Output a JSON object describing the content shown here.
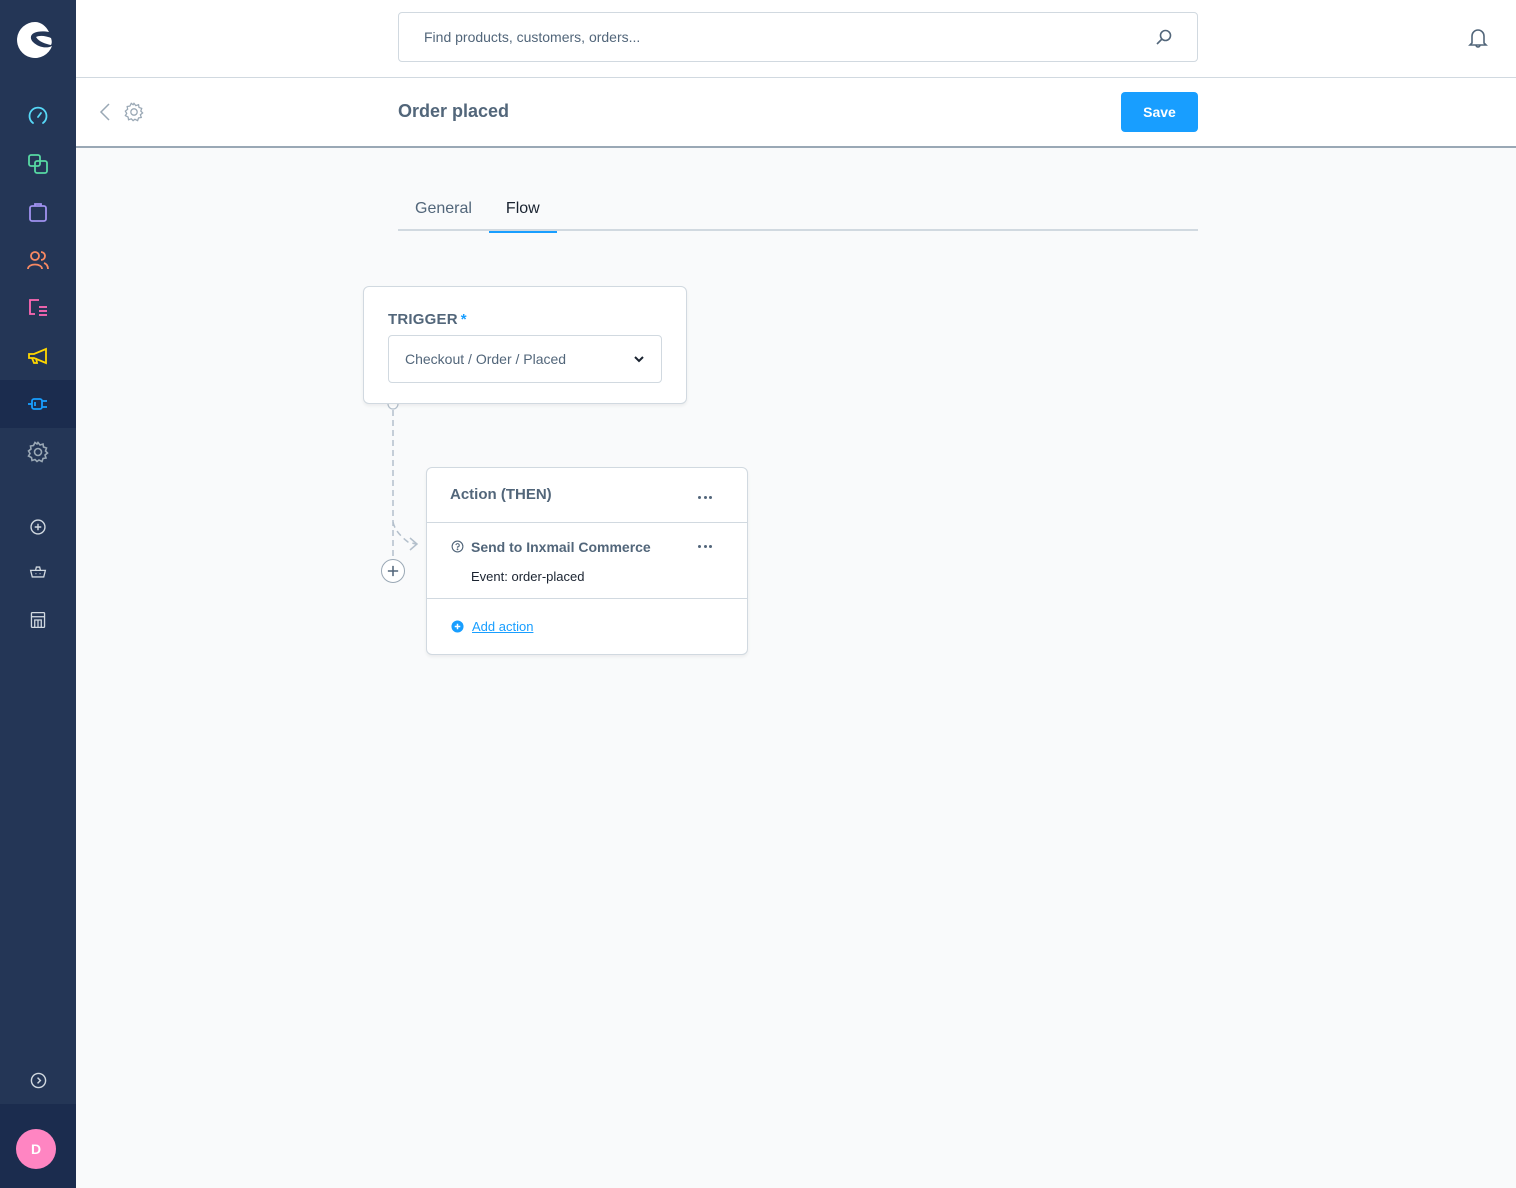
{
  "sidebar": {
    "logo": "shopware-logo-icon",
    "items": [
      {
        "name": "dashboard",
        "icon": "gauge-icon",
        "color": "#57d9f8",
        "active": false
      },
      {
        "name": "catalogues",
        "icon": "products-icon",
        "color": "#57d9a3",
        "active": false
      },
      {
        "name": "orders",
        "icon": "shopping-bag-icon",
        "color": "#a092f0",
        "active": false
      },
      {
        "name": "customers",
        "icon": "users-icon",
        "color": "#f88962",
        "active": false
      },
      {
        "name": "content",
        "icon": "content-icon",
        "color": "#ff68b4",
        "active": false
      },
      {
        "name": "marketing",
        "icon": "megaphone-icon",
        "color": "#ffd700",
        "active": false
      },
      {
        "name": "extensions",
        "icon": "plug-icon",
        "color": "#189eff",
        "active": true
      },
      {
        "name": "settings",
        "icon": "gear-icon",
        "color": "#9aa8b5",
        "active": false
      }
    ],
    "secondary": [
      {
        "name": "add-sales-channel",
        "icon": "plus-circle-icon"
      },
      {
        "name": "headless-channel",
        "icon": "basket-icon"
      },
      {
        "name": "storefront-channel",
        "icon": "storefront-icon"
      }
    ],
    "collapse_icon": "chevron-circle-right-icon",
    "avatar_initial": "D",
    "avatar_color": "#ff85c2"
  },
  "header": {
    "search_placeholder": "Find products, customers, orders...",
    "search_value": ""
  },
  "smartbar": {
    "title": "Order placed",
    "save_label": "Save",
    "accent": "#189eff"
  },
  "tabs": [
    {
      "label": "General",
      "active": false
    },
    {
      "label": "Flow",
      "active": true
    }
  ],
  "trigger": {
    "label": "TRIGGER",
    "required_mark": "*",
    "selected_value": "Checkout / Order / Placed"
  },
  "action_block": {
    "title": "Action (THEN)",
    "items": [
      {
        "title": "Send to Inxmail Commerce",
        "subtitle": "Event: order-placed"
      }
    ],
    "add_action_label": "Add action"
  }
}
